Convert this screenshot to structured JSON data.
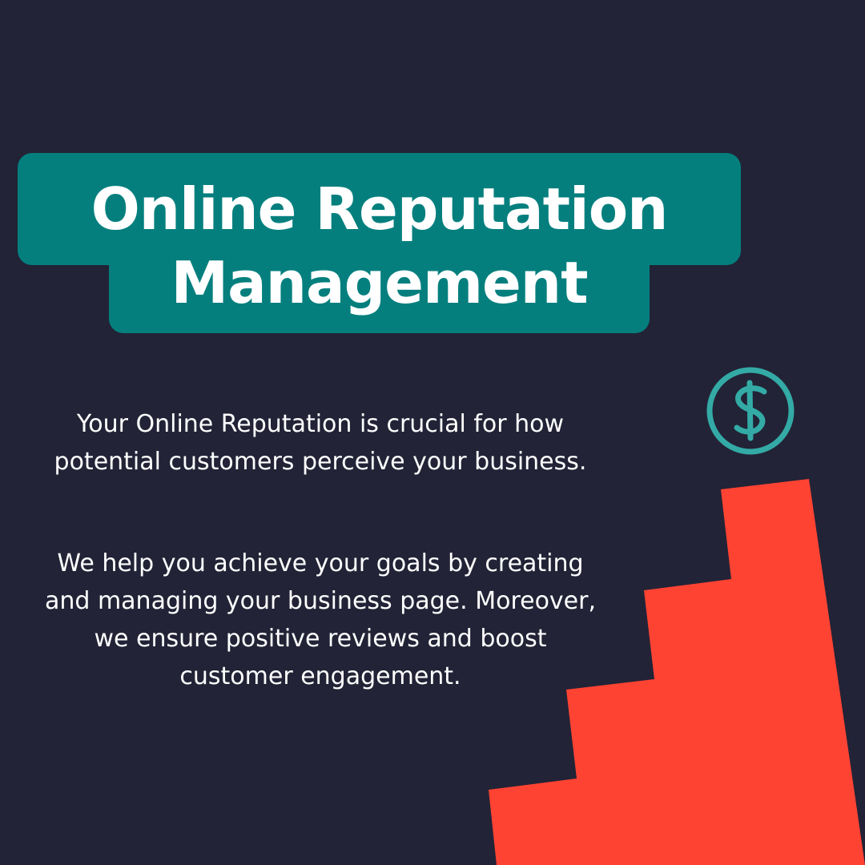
{
  "title": {
    "line1": "Online Reputation",
    "line2": "Management"
  },
  "paragraphs": [
    "Your Online Reputation is crucial for how potential customers perceive your business.",
    "We help you achieve your goals by creating and managing your business page. Moreover, we ensure positive reviews and boost customer engagement."
  ],
  "icons": {
    "dollar": "dollar-icon"
  },
  "colors": {
    "background": "#222336",
    "title_background": "#047f7e",
    "title_text": "#ffffff",
    "body_text": "#ffffff",
    "accent_teal": "#34aaa6",
    "steps": "#ff4333"
  }
}
